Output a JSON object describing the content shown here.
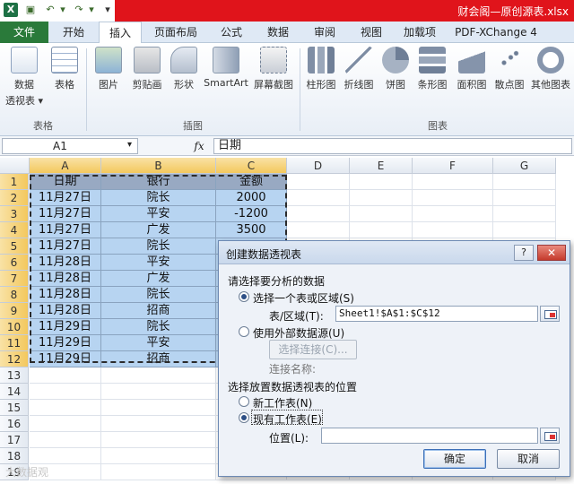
{
  "window": {
    "title": "财会阁—原创源表.xlsx"
  },
  "ribbon": {
    "tabs": [
      "文件",
      "开始",
      "插入",
      "页面布局",
      "公式",
      "数据",
      "审阅",
      "视图",
      "加载项",
      "PDF-XChange 4"
    ],
    "active_tab": "插入",
    "groups": {
      "tables": {
        "label": "表格",
        "pivot_line1": "数据",
        "pivot_line2": "透视表 ▾",
        "table": "表格"
      },
      "illustrations": {
        "label": "插图",
        "picture": "图片",
        "clipart": "剪贴画",
        "shapes": "形状",
        "smartart": "SmartArt",
        "screenshot": "屏幕截图"
      },
      "charts": {
        "label": "图表",
        "column": "柱形图",
        "line": "折线图",
        "pie": "饼图",
        "bar": "条形图",
        "area": "面积图",
        "scatter": "散点图",
        "other": "其他图表"
      }
    }
  },
  "formula_bar": {
    "name_box": "A1",
    "fx": "fx",
    "content": "日期"
  },
  "sheet": {
    "columns": [
      "A",
      "B",
      "C",
      "D",
      "E",
      "F",
      "G"
    ],
    "rows": [
      "1",
      "2",
      "3",
      "4",
      "5",
      "6",
      "7",
      "8",
      "9",
      "10",
      "11",
      "12",
      "13",
      "14",
      "15",
      "16",
      "17",
      "18",
      "19"
    ],
    "header": [
      "日期",
      "银行",
      "金额"
    ],
    "data": [
      [
        "11月27日",
        "院长",
        "2000"
      ],
      [
        "11月27日",
        "平安",
        "-1200"
      ],
      [
        "11月27日",
        "广发",
        "3500"
      ],
      [
        "11月27日",
        "院长",
        ""
      ],
      [
        "11月28日",
        "平安",
        ""
      ],
      [
        "11月28日",
        "广发",
        ""
      ],
      [
        "11月28日",
        "院长",
        ""
      ],
      [
        "11月28日",
        "招商",
        ""
      ],
      [
        "11月29日",
        "院长",
        ""
      ],
      [
        "11月29日",
        "平安",
        ""
      ],
      [
        "11月29日",
        "招商",
        ""
      ]
    ]
  },
  "dialog": {
    "title": "创建数据透视表",
    "help": "?",
    "close": "✕",
    "section1": "请选择要分析的数据",
    "opt_range": "选择一个表或区域(S)",
    "range_label": "表/区域(T):",
    "range_value": "Sheet1!$A$1:$C$12",
    "opt_external": "使用外部数据源(U)",
    "choose_conn": "选择连接(C)...",
    "conn_name": "连接名称:",
    "section2": "选择放置数据透视表的位置",
    "opt_new": "新工作表(N)",
    "opt_existing": "现有工作表(E)",
    "location_label": "位置(L):",
    "location_value": "",
    "ok": "确定",
    "cancel": "取消"
  },
  "watermark": "大数据观"
}
